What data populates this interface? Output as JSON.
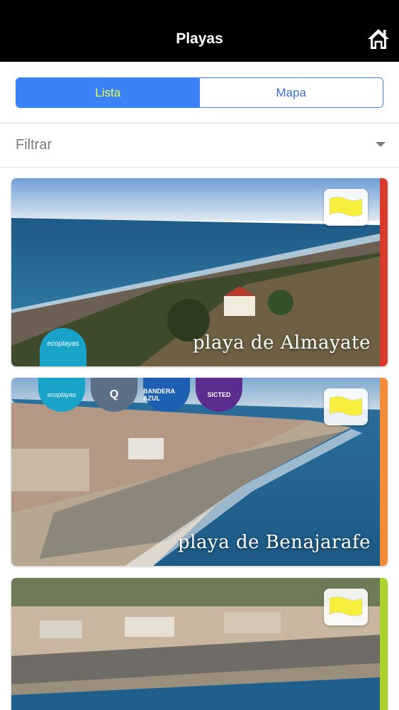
{
  "header": {
    "title": "Playas",
    "home_icon": "home-icon"
  },
  "segments": [
    {
      "label": "Lista",
      "active": true
    },
    {
      "label": "Mapa",
      "active": false
    }
  ],
  "filter": {
    "label": "Filtrar",
    "icon": "caret-down-icon"
  },
  "beaches": [
    {
      "name": "playa de Almayate",
      "stripe_color": "#d93a2b",
      "flag_color": "#f7ee3c",
      "badges": [
        "ecoplayas"
      ]
    },
    {
      "name": "playa de Benajarafe",
      "stripe_color": "#f28c38",
      "flag_color": "#f7ee3c",
      "badges": [
        "ecoplayas",
        "Q",
        "BANDERA AZUL",
        "SICTED"
      ]
    },
    {
      "name": "",
      "stripe_color": "#a9d22a",
      "flag_color": "#f7ee3c",
      "badges": []
    }
  ],
  "colors": {
    "accent": "#3b82f6",
    "active_segment_text": "#e8ff4a"
  }
}
